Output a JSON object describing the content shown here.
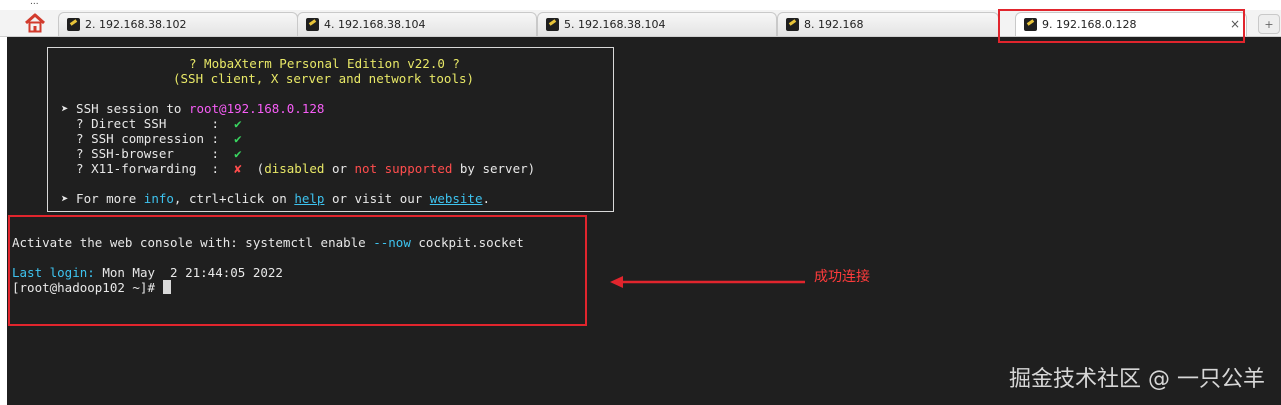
{
  "top_fragment": "...",
  "tabs": [
    {
      "label": "2. 192.168.38.102"
    },
    {
      "label": "4. 192.168.38.104"
    },
    {
      "label": "5. 192.168.38.104"
    },
    {
      "label": "8. 192.168"
    },
    {
      "label": "9. 192.168.0.128",
      "active": true,
      "close": "×"
    }
  ],
  "terminal": {
    "banner_title": "? MobaXterm Personal Edition v22.0 ?",
    "banner_subtitle": "(SSH client, X server and network tools)",
    "session_prefix": "➤ SSH session to ",
    "session_target": "root@192.168.0.128",
    "rows": [
      {
        "label": "  ? Direct SSH      :  ",
        "mark": "✔"
      },
      {
        "label": "  ? SSH compression :  ",
        "mark": "✔"
      },
      {
        "label": "  ? SSH-browser     :  ",
        "mark": "✔"
      },
      {
        "label": "  ? X11-forwarding  :  ",
        "mark": "✘"
      }
    ],
    "x11_note_open": "  (",
    "x11_disabled": "disabled",
    "x11_or": " or ",
    "x11_not_supported": "not supported",
    "x11_tail": " by server)",
    "more_prefix": "➤ For more ",
    "more_info": "info",
    "more_mid": ", ctrl+click on ",
    "more_help": "help",
    "more_visit": " or visit our ",
    "more_website": "website",
    "more_end": ".",
    "activate_prefix": "Activate the web console with: systemctl enable ",
    "activate_flag": "--now",
    "activate_suffix": " cockpit.socket",
    "last_login_label": "Last login:",
    "last_login_value": " Mon May  2 21:44:05 2022",
    "prompt": "[root@hadoop102 ~]# "
  },
  "annotation": {
    "label": "成功连接",
    "color": "#e1252d"
  },
  "watermark": "掘金技术社区 @ 一只公羊"
}
